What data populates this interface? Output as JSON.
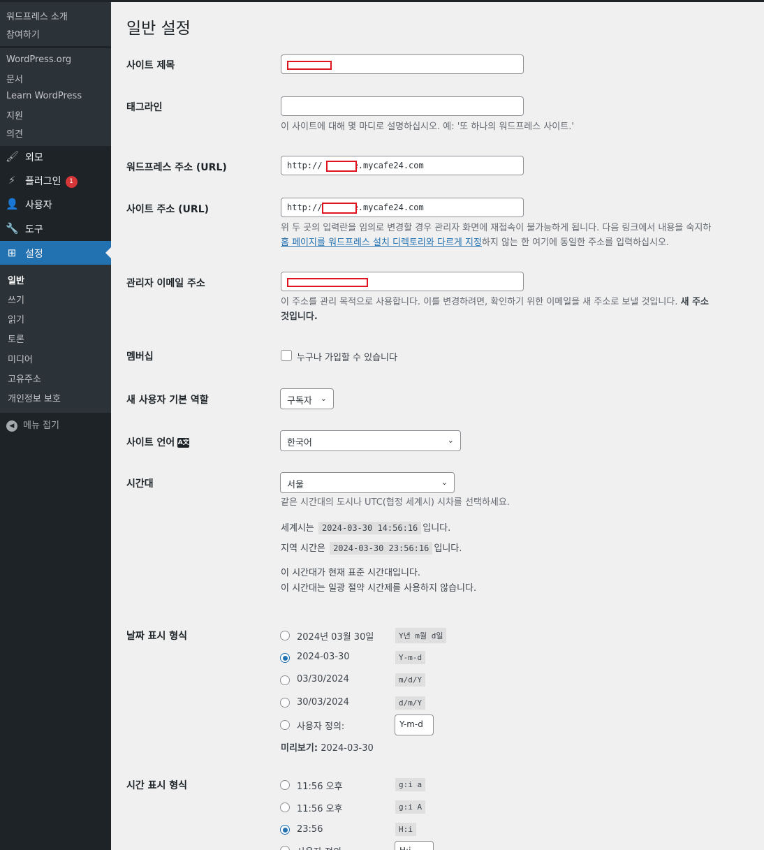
{
  "sidebar": {
    "top_sub": [
      "워드프레스 소개",
      "참여하기"
    ],
    "links_sub": [
      "WordPress.org",
      "문서",
      "Learn WordPress",
      "지원",
      "의견"
    ],
    "main_items": [
      {
        "label": "외모",
        "icon": "paintbrush-icon"
      },
      {
        "label": "플러그인",
        "icon": "plugin-icon",
        "badge": "1"
      },
      {
        "label": "사용자",
        "icon": "user-icon"
      },
      {
        "label": "도구",
        "icon": "wrench-icon"
      },
      {
        "label": "설정",
        "icon": "settings-icon"
      }
    ],
    "settings_sub": [
      "일반",
      "쓰기",
      "읽기",
      "토론",
      "미디어",
      "고유주소",
      "개인정보 보호"
    ],
    "collapse": "메뉴 접기"
  },
  "page": {
    "title": "일반 설정",
    "site_title": {
      "label": "사이트 제목",
      "value": ""
    },
    "tagline": {
      "label": "태그라인",
      "value": "",
      "desc": "이 사이트에 대해 몇 마디로 설명하십시오. 예: '또 하나의 워드프레스 사이트.'"
    },
    "wp_url": {
      "label": "워드프레스 주소 (URL)",
      "prefix": "http://",
      "suffix": "e.mycafe24.com"
    },
    "site_url": {
      "label": "사이트 주소 (URL)",
      "prefix": "http://",
      "suffix": "e.mycafe24.com",
      "desc1": "위 두 곳의 입력란을 임의로 변경할 경우 관리자 화면에 재접속이 불가능하게 됩니다. 다음 링크에서 내용을 숙지하",
      "desc2_link": "홈 페이지를 워드프레스 설치 디렉토리와 다르게 지정",
      "desc2_rest": "하지 않는 한 여기에 동일한 주소를 입력하십시오."
    },
    "admin_email": {
      "label": "관리자 이메일 주소",
      "desc1": "이 주소를 관리 목적으로 사용합니다. 이를 변경하려면, 확인하기 위한 이메일을 새 주소로 보낼 것입니다.",
      "desc1_bold": "새 주소",
      "desc2": "것입니다."
    },
    "membership": {
      "label": "멤버십",
      "checkbox_label": "누구나 가입할 수 있습니다"
    },
    "default_role": {
      "label": "새 사용자 기본 역할",
      "value": "구독자"
    },
    "site_language": {
      "label": "사이트 언어",
      "value": "한국어"
    },
    "timezone": {
      "label": "시간대",
      "value": "서울",
      "desc": "같은 시간대의 도시나 UTC(협정 세계시) 시차를 선택하세요.",
      "utc_prefix": "세계시는",
      "utc_time": "2024-03-30 14:56:16",
      "utc_suffix": "입니다.",
      "local_prefix": "지역 시간은",
      "local_time": "2024-03-30 23:56:16",
      "local_suffix": "입니다.",
      "std_note": "이 시간대가 현재 표준 시간대입니다.",
      "dst_note": "이 시간대는 일광 절약 시간제를 사용하지 않습니다."
    },
    "date_format": {
      "label": "날짜 표시 형식",
      "options": [
        {
          "label": "2024년 03월 30일",
          "code": "Y년 m월 d일",
          "checked": false
        },
        {
          "label": "2024-03-30",
          "code": "Y-m-d",
          "checked": true
        },
        {
          "label": "03/30/2024",
          "code": "m/d/Y",
          "checked": false
        },
        {
          "label": "30/03/2024",
          "code": "d/m/Y",
          "checked": false
        }
      ],
      "custom_label": "사용자 정의:",
      "custom_value": "Y-m-d",
      "preview_label": "미리보기:",
      "preview_value": "2024-03-30"
    },
    "time_format": {
      "label": "시간 표시 형식",
      "options": [
        {
          "label": "11:56 오후",
          "code": "g:i a",
          "checked": false
        },
        {
          "label": "11:56 오후",
          "code": "g:i A",
          "checked": false
        },
        {
          "label": "23:56",
          "code": "H:i",
          "checked": true
        }
      ],
      "custom_label": "사용자 정의:",
      "custom_value": "H:i"
    }
  },
  "colors": {
    "accent": "#2271b1",
    "sidebar": "#1d2327",
    "badge": "#d63638",
    "redaction": "#e0141e"
  }
}
